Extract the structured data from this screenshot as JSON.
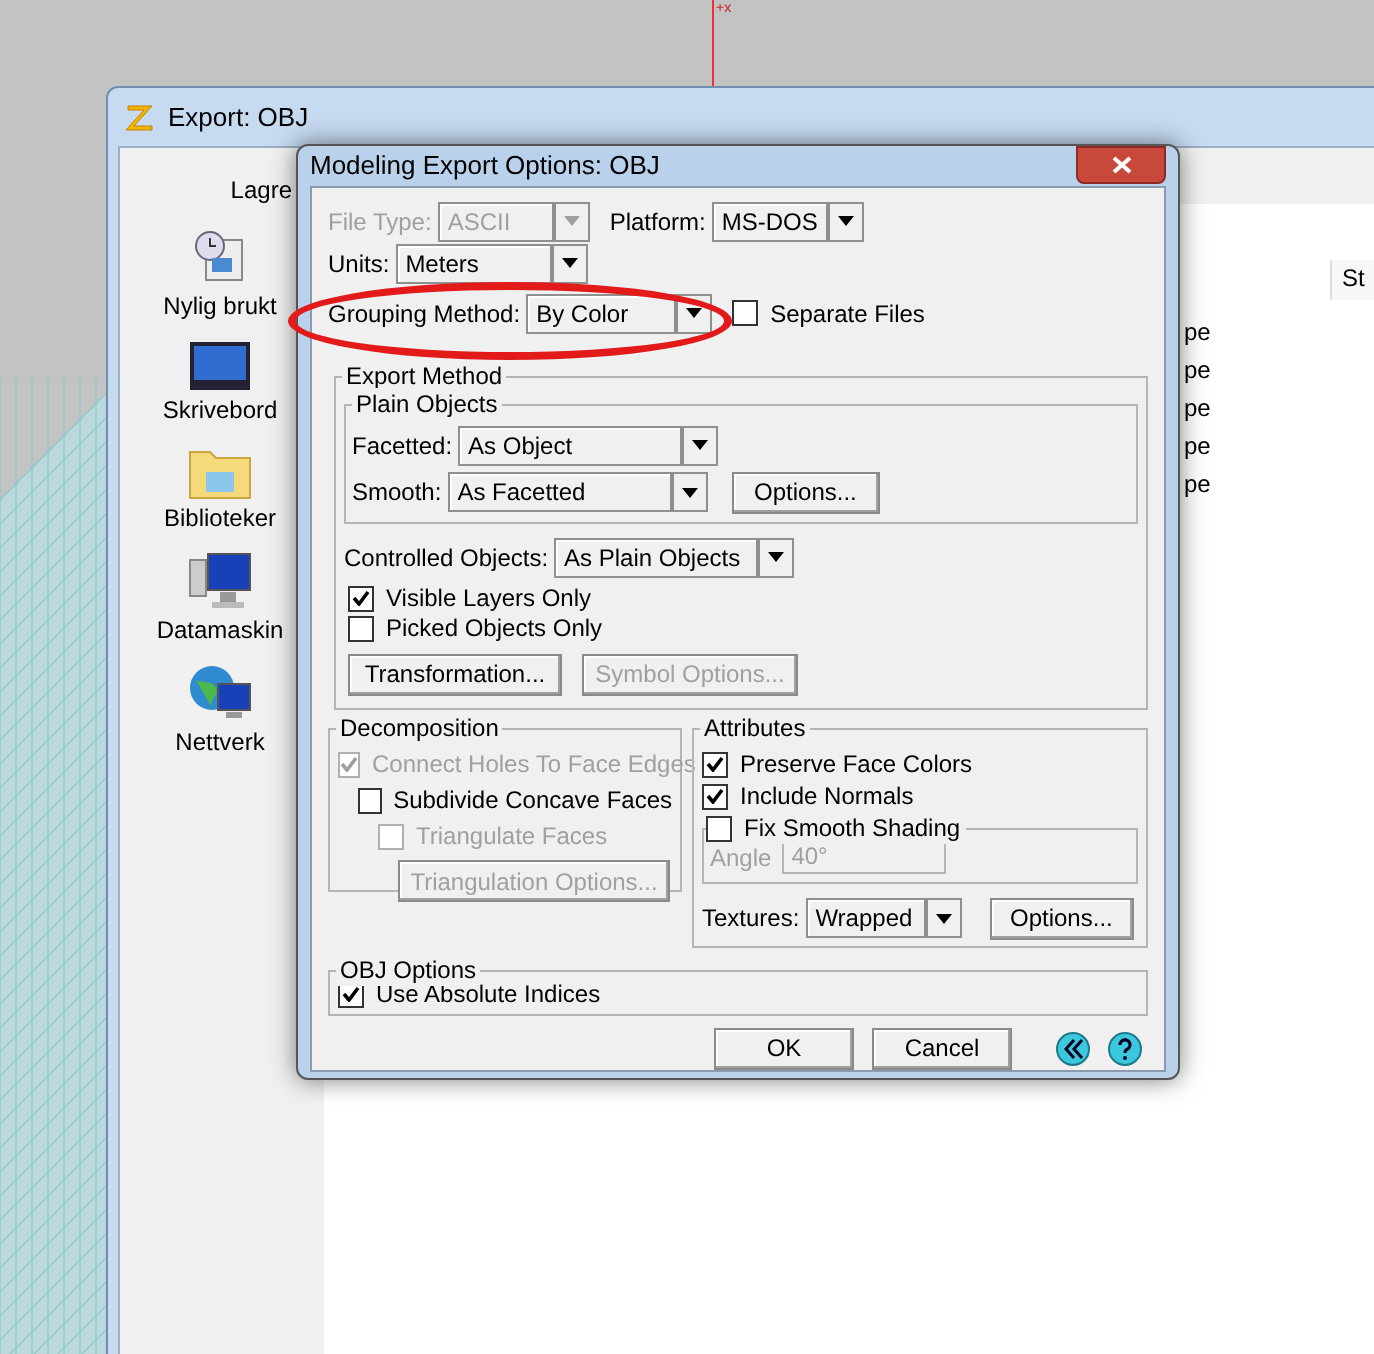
{
  "viewport": {
    "axis_label": "+x"
  },
  "export_window": {
    "title": "Export: OBJ",
    "save_in_label": "Lagre",
    "places": [
      {
        "label": "Nylig brukt",
        "kind": "recent"
      },
      {
        "label": "Skrivebord",
        "kind": "desktop"
      },
      {
        "label": "Biblioteker",
        "kind": "libraries"
      },
      {
        "label": "Datamaskin",
        "kind": "computer"
      },
      {
        "label": "Nettverk",
        "kind": "network"
      }
    ],
    "file_list": {
      "column_header": "St",
      "rows": [
        "pe",
        "pe",
        "pe",
        "pe",
        "pe"
      ]
    }
  },
  "options_dialog": {
    "title": "Modeling Export Options: OBJ",
    "file_type": {
      "label": "File Type:",
      "value": "ASCII",
      "disabled": true
    },
    "platform": {
      "label": "Platform:",
      "value": "MS-DOS",
      "disabled": false
    },
    "units": {
      "label": "Units:",
      "value": "Meters",
      "disabled": false
    },
    "grouping_method": {
      "label": "Grouping Method:",
      "value": "By Color",
      "disabled": false
    },
    "separate_files": {
      "label": "Separate Files",
      "checked": false,
      "disabled": false
    },
    "export_method": {
      "title": "Export Method",
      "plain_objects": {
        "title": "Plain Objects",
        "facetted": {
          "label": "Facetted:",
          "value": "As Object",
          "disabled": false
        },
        "smooth": {
          "label": "Smooth:",
          "value": "As Facetted",
          "disabled": false
        },
        "options_button": {
          "label": "Options...",
          "disabled": false
        }
      },
      "controlled_objects": {
        "label": "Controlled Objects:",
        "value": "As Plain Objects",
        "disabled": false
      },
      "checkboxes": [
        {
          "label": "Visible Layers Only",
          "checked": true,
          "disabled": false
        },
        {
          "label": "Picked Objects Only",
          "checked": false,
          "disabled": false
        }
      ],
      "buttons": [
        {
          "label": "Transformation...",
          "disabled": false
        },
        {
          "label": "Symbol Options...",
          "disabled": true
        }
      ]
    },
    "decomposition": {
      "title": "Decomposition",
      "checkboxes": [
        {
          "label": "Connect Holes To Face Edges",
          "checked": true,
          "disabled": true,
          "children": [
            {
              "label": "Subdivide Concave Faces",
              "checked": false,
              "disabled": false,
              "children": [
                {
                  "label": "Triangulate Faces",
                  "checked": false,
                  "disabled": true
                }
              ]
            }
          ]
        }
      ],
      "button": {
        "label": "Triangulation Options...",
        "disabled": true
      }
    },
    "attributes": {
      "title": "Attributes",
      "checkboxes": [
        {
          "label": "Preserve Face Colors",
          "checked": true,
          "disabled": false
        },
        {
          "label": "Include Normals",
          "checked": true,
          "disabled": false
        }
      ],
      "fix_smooth_shading": {
        "label": "Fix Smooth Shading",
        "checked": false,
        "disabled": false,
        "angle_label": "Angle",
        "angle_value": "40°",
        "angle_disabled": true
      },
      "textures": {
        "label": "Textures:",
        "value": "Wrapped",
        "disabled": false
      },
      "options_button": {
        "label": "Options...",
        "disabled": false
      }
    },
    "obj_options": {
      "title": "OBJ Options",
      "checkboxes": [
        {
          "label": "Use Absolute Indices",
          "checked": true,
          "disabled": false
        }
      ]
    },
    "buttons": [
      {
        "label": "OK",
        "disabled": false
      },
      {
        "label": "Cancel",
        "disabled": false
      }
    ]
  }
}
